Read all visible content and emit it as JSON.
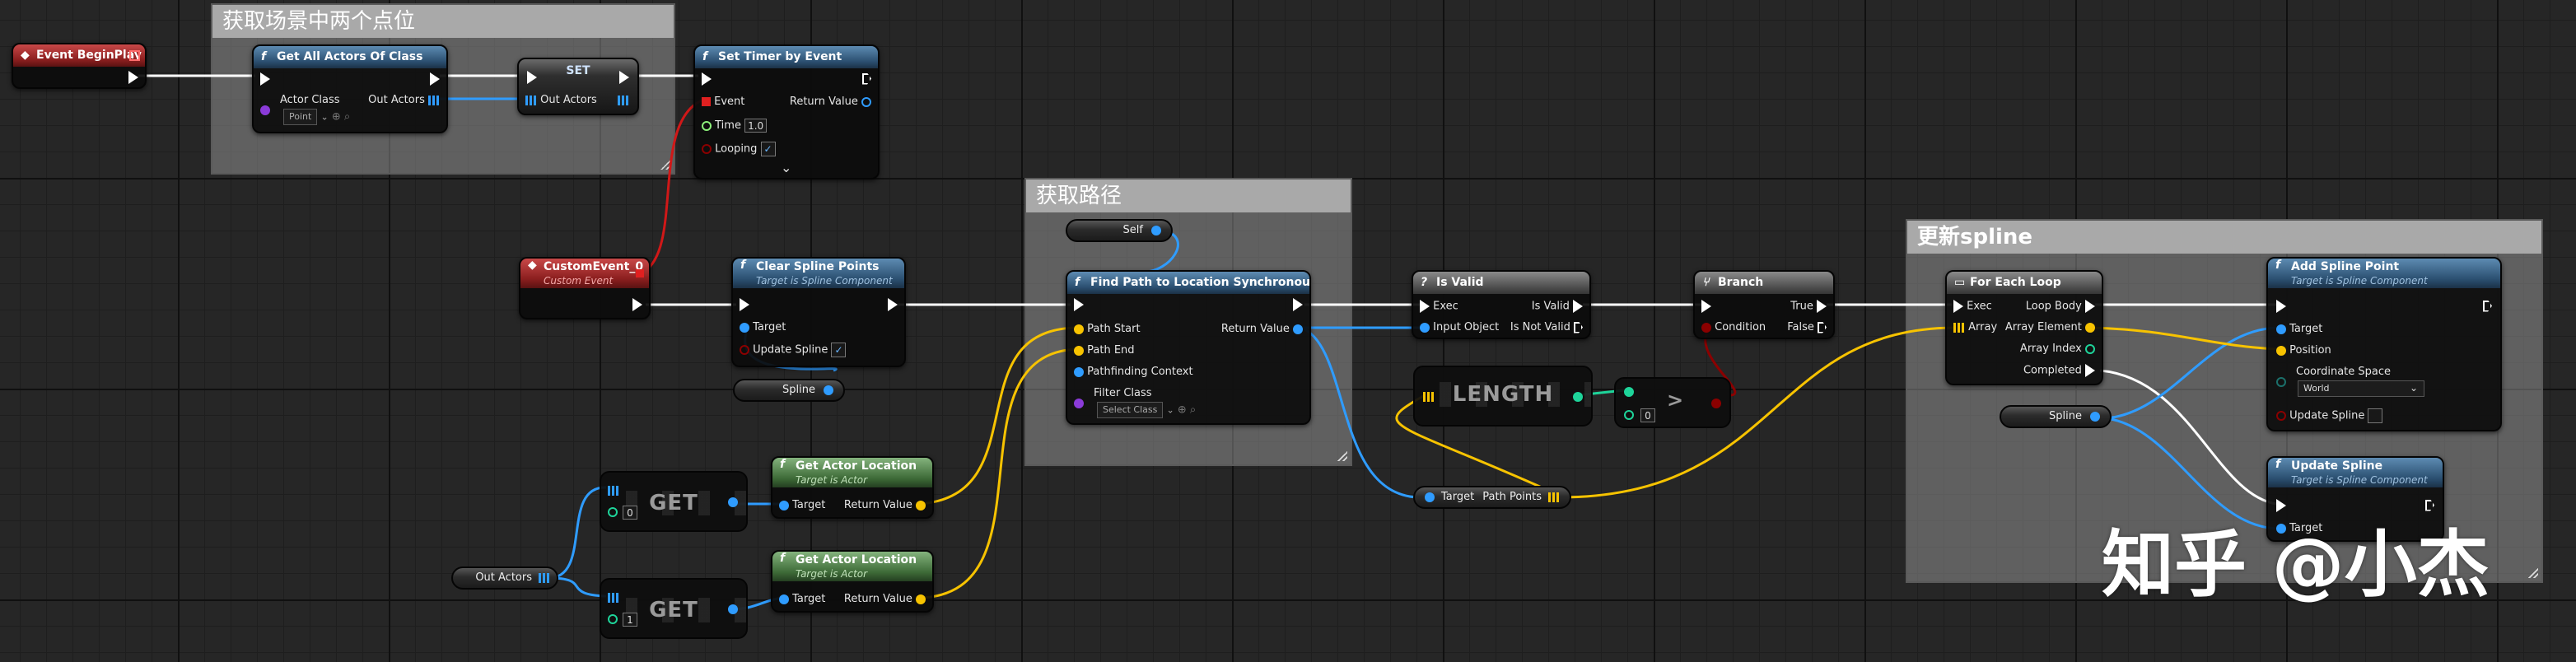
{
  "comments": {
    "get_points": "获取场景中两个点位",
    "get_path": "获取路径",
    "update_spline": "更新spline"
  },
  "event_begin_play": {
    "title": "Event BeginPlay"
  },
  "get_all_actors": {
    "title": "Get All Actors Of Class",
    "actor_class_label": "Actor Class",
    "actor_class_value": "Point",
    "out_actors_label": "Out Actors"
  },
  "set_node": {
    "title": "SET",
    "out_actors_label": "Out Actors"
  },
  "set_timer": {
    "title": "Set Timer by Event",
    "event_label": "Event",
    "return_value_label": "Return Value",
    "time_label": "Time",
    "time_value": "1.0",
    "looping_label": "Looping",
    "check": "✓",
    "expand": "⌄"
  },
  "custom_event": {
    "title": "CustomEvent_0",
    "subtitle": "Custom Event"
  },
  "clear_spline": {
    "title": "Clear Spline Points",
    "subtitle": "Target is Spline Component",
    "target_label": "Target",
    "update_spline_label": "Update Spline",
    "check": "✓"
  },
  "spline_var_1": {
    "label": "Spline"
  },
  "self_var": {
    "label": "Self"
  },
  "find_path": {
    "title": "Find Path to Location Synchronously",
    "path_start_label": "Path Start",
    "path_end_label": "Path End",
    "pathfinding_context_label": "Pathfinding Context",
    "filter_class_label": "Filter Class",
    "filter_class_value": "Select Class",
    "return_value_label": "Return Value"
  },
  "is_valid": {
    "title": "Is Valid",
    "exec_label": "Exec",
    "input_object_label": "Input Object",
    "is_valid_label": "Is Valid",
    "is_not_valid_label": "Is Not Valid"
  },
  "branch": {
    "title": "Branch",
    "condition_label": "Condition",
    "true_label": "True",
    "false_label": "False"
  },
  "length_node": {
    "label": "LENGTH"
  },
  "greater_node": {
    "symbol": ">",
    "value": "0"
  },
  "break_path": {
    "target_label": "Target",
    "path_points_label": "Path Points"
  },
  "get_node_0": {
    "label": "GET",
    "index": "0"
  },
  "get_node_1": {
    "label": "GET",
    "index": "1"
  },
  "get_actor_location_0": {
    "title": "Get Actor Location",
    "subtitle": "Target is Actor",
    "target_label": "Target",
    "return_value_label": "Return Value"
  },
  "get_actor_location_1": {
    "title": "Get Actor Location",
    "subtitle": "Target is Actor",
    "target_label": "Target",
    "return_value_label": "Return Value"
  },
  "out_actors_var": {
    "label": "Out Actors"
  },
  "for_each": {
    "title": "For Each Loop",
    "exec_label": "Exec",
    "array_label": "Array",
    "loop_body_label": "Loop Body",
    "array_element_label": "Array Element",
    "array_index_label": "Array Index",
    "completed_label": "Completed"
  },
  "spline_var_2": {
    "label": "Spline"
  },
  "add_spline_point": {
    "title": "Add Spline Point",
    "subtitle": "Target is Spline Component",
    "target_label": "Target",
    "position_label": "Position",
    "coordinate_space_label": "Coordinate Space",
    "coordinate_space_value": "World",
    "update_spline_label": "Update Spline"
  },
  "update_spline": {
    "title": "Update Spline",
    "subtitle": "Target is Spline Component",
    "target_label": "Target"
  },
  "watermark": "知乎 @小杰",
  "colors": {
    "exec_wire": "#ffffff",
    "object_wire": "#2f9cff",
    "vector_wire": "#f7c300",
    "event_wire": "#d01818",
    "bool_wire": "#8b0000",
    "int_wire": "#1ed49a"
  }
}
